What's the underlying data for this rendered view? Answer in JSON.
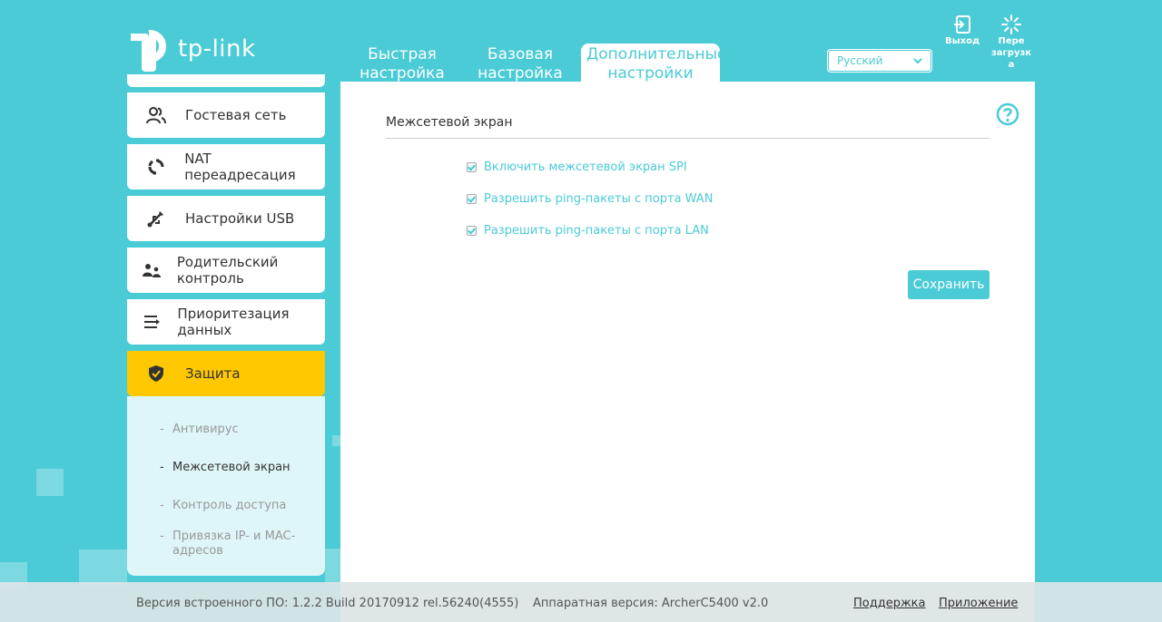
{
  "brand": {
    "logo_text": "tp-link"
  },
  "header": {
    "tabs": [
      {
        "label": "Быстрая настройка"
      },
      {
        "label": "Базовая настройка"
      },
      {
        "label": "Дополнительные настройки",
        "active": true
      }
    ],
    "language": {
      "selected": "Русский"
    },
    "exit_label": "Выход",
    "reboot_label": "Пере загрузк а"
  },
  "sidebar": {
    "items": [
      {
        "label": "Гостевая сеть",
        "icon": "guest-network-icon"
      },
      {
        "label": "NAT переадресация",
        "icon": "nat-forwarding-icon"
      },
      {
        "label": "Настройки USB",
        "icon": "usb-icon"
      },
      {
        "label": "Родительский контроль",
        "icon": "parental-control-icon"
      },
      {
        "label": "Приоритезация данных",
        "icon": "qos-icon"
      },
      {
        "label": "Защита",
        "icon": "shield-icon",
        "active": true
      }
    ],
    "submenu": [
      {
        "label": "Антивирус"
      },
      {
        "label": "Межсетевой экран",
        "current": true
      },
      {
        "label": "Контроль доступа"
      },
      {
        "label": "Привязка IP- и MAC-адресов"
      }
    ]
  },
  "main": {
    "section_title": "Межсетевой экран",
    "options": [
      {
        "label": "Включить межсетевой экран SPI",
        "checked": true
      },
      {
        "label": "Разрешить ping-пакеты с порта WAN",
        "checked": true
      },
      {
        "label": "Разрешить ping-пакеты с порта LAN",
        "checked": true
      }
    ],
    "save_label": "Сохранить"
  },
  "footer": {
    "firmware": "Версия встроенного ПО: 1.2.2 Build 20170912 rel.56240(4555)",
    "hardware": "Аппаратная версия: ArcherC5400 v2.0",
    "support_link": "Поддержка",
    "app_link": "Приложение"
  },
  "colors": {
    "accent": "#4acbd6",
    "active": "#ffc800"
  }
}
